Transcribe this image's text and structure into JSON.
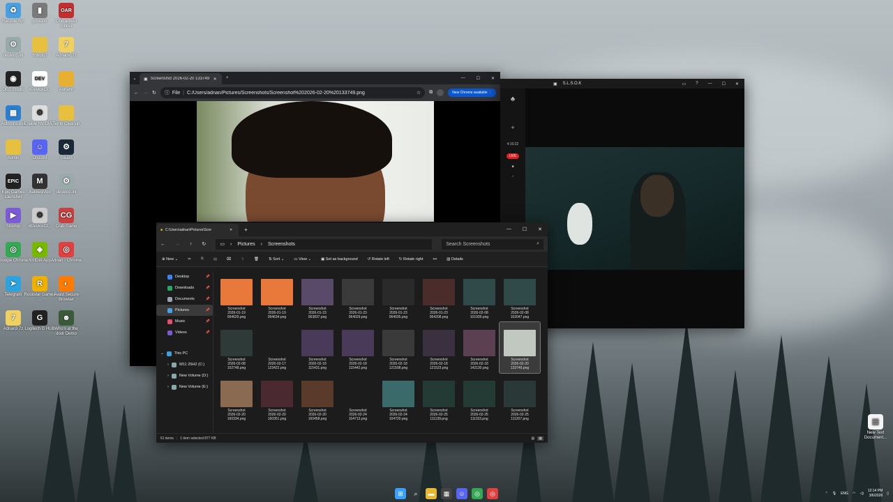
{
  "desktop": {
    "icons": [
      {
        "label": "Recycle Bin",
        "icon": "recycle-bin-icon",
        "color": "#4a9fe0",
        "glyph": "♻"
      },
      {
        "label": "goskam",
        "icon": "trash-can-icon",
        "color": "#7a7a7a",
        "glyph": "▮"
      },
      {
        "label": "One armed robber",
        "icon": "one-armed-robber-icon",
        "color": "#c03030",
        "glyph": "OAR"
      },
      {
        "label": "desktop.ini",
        "icon": "file-icon",
        "color": "#9aa",
        "glyph": "⚙"
      },
      {
        "label": "Yobuto7",
        "icon": "folder-icon",
        "color": "#e8c040",
        "glyph": ""
      },
      {
        "label": "Adnanvi.7z",
        "icon": "archive-icon",
        "color": "#f0d060",
        "glyph": "7"
      },
      {
        "label": "OBS Studio",
        "icon": "obs-icon",
        "color": "#222",
        "glyph": "◉"
      },
      {
        "label": "#DeviceCl...",
        "icon": "devcln-icon",
        "color": "#fff",
        "glyph": "DEV"
      },
      {
        "label": "Adnann",
        "icon": "folder-icon",
        "color": "#e8b030",
        "glyph": ""
      },
      {
        "label": "Autoruns.exe",
        "icon": "autoruns-icon",
        "color": "#2a7fd0",
        "glyph": "▦"
      },
      {
        "label": "Enable NVIDIA...",
        "icon": "script-icon",
        "color": "#ddd",
        "glyph": "⚙"
      },
      {
        "label": "Temp Cleanup",
        "icon": "folder-icon",
        "color": "#e8c040",
        "glyph": ""
      },
      {
        "label": "Admin",
        "icon": "folder-icon",
        "color": "#e8c040",
        "glyph": ""
      },
      {
        "label": "Discord",
        "icon": "discord-icon",
        "color": "#5865f2",
        "glyph": "☺"
      },
      {
        "label": "Steam",
        "icon": "steam-icon",
        "color": "#1b2838",
        "glyph": "⚙"
      },
      {
        "label": "Epic Games Launcher",
        "icon": "epic-games-icon",
        "color": "#222",
        "glyph": "EPIC"
      },
      {
        "label": "BakkesMod",
        "icon": "bakkesmod-icon",
        "color": "#333",
        "glyph": "M"
      },
      {
        "label": "desktop.ini",
        "icon": "file-icon",
        "color": "#9aa",
        "glyph": "⚙"
      },
      {
        "label": "Stremio",
        "icon": "stremio-icon",
        "color": "#7b5bd6",
        "glyph": "▶"
      },
      {
        "label": "#DeviceCl...",
        "icon": "file-icon",
        "color": "#ccc",
        "glyph": "⚙"
      },
      {
        "label": "Crab Game",
        "icon": "crab-game-icon",
        "color": "#c84040",
        "glyph": "CG"
      },
      {
        "label": "Google Chrome",
        "icon": "chrome-icon",
        "color": "#34a853",
        "glyph": "◎"
      },
      {
        "label": "NVIDIA App",
        "icon": "nvidia-icon",
        "color": "#76b900",
        "glyph": "◈"
      },
      {
        "label": "Adnan - Chrome",
        "icon": "chrome-icon",
        "color": "#e04040",
        "glyph": "◎"
      },
      {
        "label": "Telegram",
        "icon": "telegram-icon",
        "color": "#2aa3e0",
        "glyph": "➤"
      },
      {
        "label": "Rockstar Games ...",
        "icon": "rockstar-icon",
        "color": "#f0b000",
        "glyph": "R"
      },
      {
        "label": "Avast Secure Browser",
        "icon": "avast-icon",
        "color": "#ff7a00",
        "glyph": "◐"
      },
      {
        "label": "Adnan3.7z",
        "icon": "archive-icon",
        "color": "#f0d060",
        "glyph": "7"
      },
      {
        "label": "Logitech G HUB",
        "icon": "logitech-icon",
        "color": "#222",
        "glyph": "G"
      },
      {
        "label": "Who's at the door Demo",
        "icon": "game-icon",
        "color": "#3a5a3a",
        "glyph": "☻"
      }
    ],
    "right_icon": {
      "label": "New Text Document...",
      "icon": "text-file-icon"
    }
  },
  "chrome": {
    "tab_title": "Screenshot 2026-02-20 133749",
    "file_badge": "File",
    "url": "C:/Users/adnan/Pictures/Screenshots/Screenshot%202026-02-20%20133749.png",
    "new_chrome": "New Chrome available"
  },
  "stream": {
    "title": "S.L.S.O.K",
    "timer": "4:10:22",
    "live": "LIVE"
  },
  "explorer": {
    "tab_title": "C:\\Users\\adnan\\Pictures\\Scre",
    "breadcrumb": [
      "Pictures",
      "Screenshots"
    ],
    "search_placeholder": "Search Screenshots",
    "commands": {
      "new": "New",
      "sort": "Sort",
      "view": "View",
      "background": "Set as background",
      "rotate_left": "Rotate left",
      "rotate_right": "Rotate right",
      "details": "Details"
    },
    "nav": [
      {
        "label": "Desktop",
        "color": "#3b82f6",
        "pinned": true
      },
      {
        "label": "Downloads",
        "color": "#22aa66",
        "pinned": true
      },
      {
        "label": "Documents",
        "color": "#9aa3b0",
        "pinned": true
      },
      {
        "label": "Pictures",
        "color": "#4aa0e0",
        "pinned": true,
        "active": true
      },
      {
        "label": "Music",
        "color": "#e0506a",
        "pinned": true
      },
      {
        "label": "Videos",
        "color": "#7a5ad0",
        "pinned": true
      }
    ],
    "this_pc": "This PC",
    "drives": [
      "W11 25H2 (C:)",
      "New Volume (D:)",
      "New Volume (E:)"
    ],
    "files": [
      {
        "name": "Screenshot",
        "date": "2026-01-19",
        "time": "094629.png",
        "thumb": "#e8793a"
      },
      {
        "name": "Screenshot",
        "date": "2026-01-19",
        "time": "094634.png",
        "thumb": "#e8793a"
      },
      {
        "name": "Screenshot",
        "date": "2026-01-23",
        "time": "063837.png",
        "thumb": "#5a4a6a"
      },
      {
        "name": "Screenshot",
        "date": "2026-01-23",
        "time": "064029.png",
        "thumb": "#3a3a3a"
      },
      {
        "name": "Screenshot",
        "date": "2026-01-23",
        "time": "064035.png",
        "thumb": "#2a2a2a"
      },
      {
        "name": "Screenshot",
        "date": "2026-01-23",
        "time": "064208.png",
        "thumb": "#4a2c2a"
      },
      {
        "name": "Screenshot",
        "date": "2026-02-08",
        "time": "101939.png",
        "thumb": "#2f4a48"
      },
      {
        "name": "Screenshot",
        "date": "2026-02-08",
        "time": "102047.png",
        "thumb": "#2f4a48"
      },
      {
        "name": "Screenshot",
        "date": "2026-02-08",
        "time": "102748.png",
        "thumb": "#2e3a38"
      },
      {
        "name": "Screenshot",
        "date": "2026-02-17",
        "time": "123422.png",
        "thumb": "#1c1c1c"
      },
      {
        "name": "Screenshot",
        "date": "2026-02-18",
        "time": "115431.png",
        "thumb": "#4a3a5a"
      },
      {
        "name": "Screenshot",
        "date": "2026-02-18",
        "time": "115442.png",
        "thumb": "#4a3a5a"
      },
      {
        "name": "Screenshot",
        "date": "2026-02-18",
        "time": "121508.png",
        "thumb": "#3a3a3a"
      },
      {
        "name": "Screenshot",
        "date": "2026-02-18",
        "time": "121523.png",
        "thumb": "#3a3040"
      },
      {
        "name": "Screenshot",
        "date": "2026-02-18",
        "time": "142130.png",
        "thumb": "#5a4050"
      },
      {
        "name": "Screenshot",
        "date": "2026-02-20",
        "time": "133749.png",
        "thumb": "#c0c8c0",
        "selected": true
      },
      {
        "name": "Screenshot",
        "date": "2026-02-20",
        "time": "160334.png",
        "thumb": "#8a6a50"
      },
      {
        "name": "Screenshot",
        "date": "2026-02-20",
        "time": "160351.png",
        "thumb": "#4a2a30"
      },
      {
        "name": "Screenshot",
        "date": "2026-02-20",
        "time": "160458.png",
        "thumb": "#5a3a2a"
      },
      {
        "name": "Screenshot",
        "date": "2026-02-24",
        "time": "104713.png",
        "thumb": "#1c1c1c"
      },
      {
        "name": "Screenshot",
        "date": "2026-02-24",
        "time": "104720.png",
        "thumb": "#3a6a6a"
      },
      {
        "name": "Screenshot",
        "date": "2026-02-25",
        "time": "111139.png",
        "thumb": "#243a34"
      },
      {
        "name": "Screenshot",
        "date": "2026-02-25",
        "time": "111153.png",
        "thumb": "#243a34"
      },
      {
        "name": "Screenshot",
        "date": "2026-02-25",
        "time": "111207.png",
        "thumb": "#2a3838"
      }
    ],
    "status": {
      "count": "61 items",
      "selected": "1 item selected  877 KB"
    }
  },
  "taskbar": {
    "apps": [
      {
        "name": "start-button",
        "glyph": "⊞",
        "color": "#3aa0ff"
      },
      {
        "name": "search-icon",
        "glyph": "⌕",
        "color": "transparent"
      },
      {
        "name": "file-explorer-icon",
        "glyph": "▬",
        "color": "#e8b830"
      },
      {
        "name": "calendar-icon",
        "glyph": "▦",
        "color": "#444"
      },
      {
        "name": "discord-icon",
        "glyph": "☺",
        "color": "#5865f2"
      },
      {
        "name": "chrome-icon",
        "glyph": "◎",
        "color": "#34a853"
      },
      {
        "name": "chrome-profile-icon",
        "glyph": "◎",
        "color": "#e04040"
      }
    ],
    "lang": "ENG",
    "time": "12:14 PM",
    "date": "3/6/2026"
  }
}
